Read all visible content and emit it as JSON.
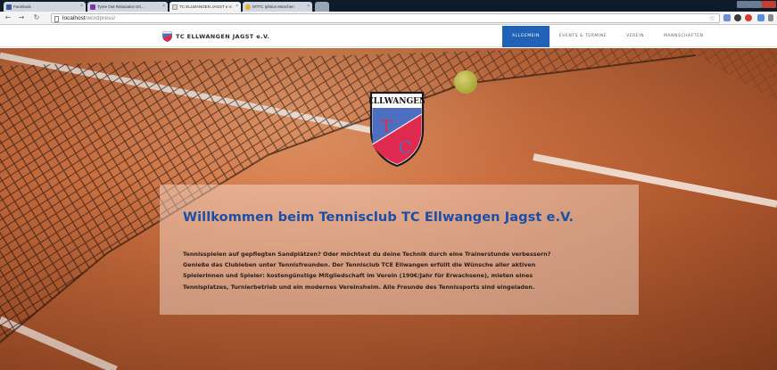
{
  "browser": {
    "tabs": [
      {
        "label": "Facebook",
        "active": false
      },
      {
        "label": "Tyme Out Relaxation Dri...",
        "active": false
      },
      {
        "label": "TC ELLWANGEN JAGST e.V.",
        "active": true
      },
      {
        "label": "MTTC Iphitos München",
        "active": false
      }
    ],
    "close_glyph": "×",
    "url_host": "localhost",
    "url_path": "/wordpress/",
    "icons": [
      "back-icon",
      "forward-icon",
      "reload-icon",
      "star-icon"
    ]
  },
  "site": {
    "brand": "TC ELLWANGEN JAGST e.V.",
    "nav": [
      "ALLGEMEIN",
      "EVENTS & TERMINE",
      "VEREIN",
      "MANNSCHAFTEN"
    ],
    "active_nav": "ALLGEMEIN",
    "accent_color": "#2062b8"
  },
  "hero": {
    "crest": {
      "name": "ELLWANGEN",
      "letters": [
        "T",
        "C"
      ],
      "colors": {
        "blue": "#4e6fbf",
        "red": "#e02a4f"
      }
    },
    "heading": "Willkommen beim Tennisclub TC Ellwangen Jagst e.V.",
    "intro_lines": [
      "Tennisspielen auf gepflegten Sandplätzen?  Oder möchtest du deine Technik durch eine Trainerstunde verbessern?",
      "Genieße das Clubleben unter Tennisfreunden.   Der Tennisclub TCE Ellwangen erfüllt die Wünsche aller aktiven",
      "SpielerInnen  und Spieler: kostengünstige Mitgliedschaft im  Verein (190€/Jahr für Erwachsene), mieten eines",
      "Tennisplatzes, Turnierbetrieb und ein modernes Vereinsheim.  Alle Freunde des Tennissports sind eingeladen."
    ]
  }
}
